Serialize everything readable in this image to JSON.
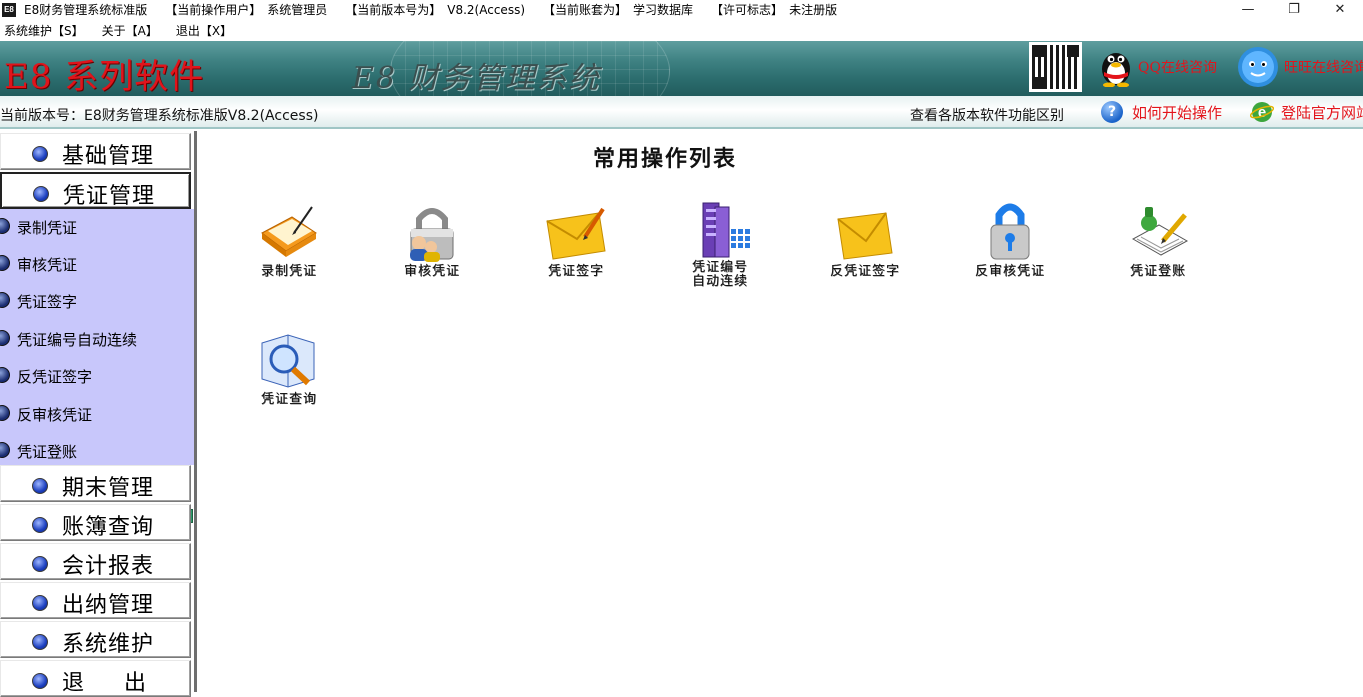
{
  "titlebar": {
    "app_icon_text": "E8",
    "app_name": "E8财务管理系统标准版",
    "user_key": "【当前操作用户】",
    "user_value": "系统管理员",
    "version_key": "【当前版本号为】",
    "version_value": "V8.2(Access)",
    "account_key": "【当前账套为】",
    "account_value": "学习数据库",
    "license_key": "【许可标志】",
    "license_value": "未注册版",
    "minimize": "—",
    "restore": "❐",
    "close": "✕"
  },
  "menubar": {
    "items": [
      "系统维护【S】",
      "关于【A】",
      "退出【X】"
    ]
  },
  "banner": {
    "brand": "E8 系列软件",
    "product": "E8 财务管理系统",
    "qq_text": "QQ在线咨询",
    "chat_text": "旺旺在线咨询"
  },
  "infobar": {
    "version_text": "当前版本号：E8财务管理系统标准版V8.2(Access)",
    "compare_link": "查看各版本软件功能区别",
    "help_icon": "?",
    "howto_link": "如何开始操作",
    "site_link": "登陆官方网站"
  },
  "sidebar": {
    "categories": [
      "基础管理",
      "凭证管理",
      "期末管理",
      "账簿查询",
      "会计报表",
      "出纳管理",
      "系统维护",
      "退出"
    ],
    "active": "凭证管理",
    "subitems": [
      "录制凭证",
      "审核凭证",
      "凭证签字",
      "凭证编号自动连续",
      "反凭证签字",
      "反审核凭证",
      "凭证登账"
    ]
  },
  "main": {
    "title": "常用操作列表",
    "ops": [
      {
        "label": "录制凭证",
        "icon": "record-voucher-icon"
      },
      {
        "label": "审核凭证",
        "icon": "audit-lock-icon"
      },
      {
        "label": "凭证签字",
        "icon": "sign-envelope-icon"
      },
      {
        "label": "凭证编号\n自动连续",
        "icon": "auto-number-icon"
      },
      {
        "label": "反凭证签字",
        "icon": "unsign-envelope-icon"
      },
      {
        "label": "反审核凭证",
        "icon": "unaudit-lock-icon"
      },
      {
        "label": "凭证登账",
        "icon": "post-ledger-icon"
      },
      {
        "label": "凭证查询",
        "icon": "query-magnifier-icon"
      }
    ]
  }
}
